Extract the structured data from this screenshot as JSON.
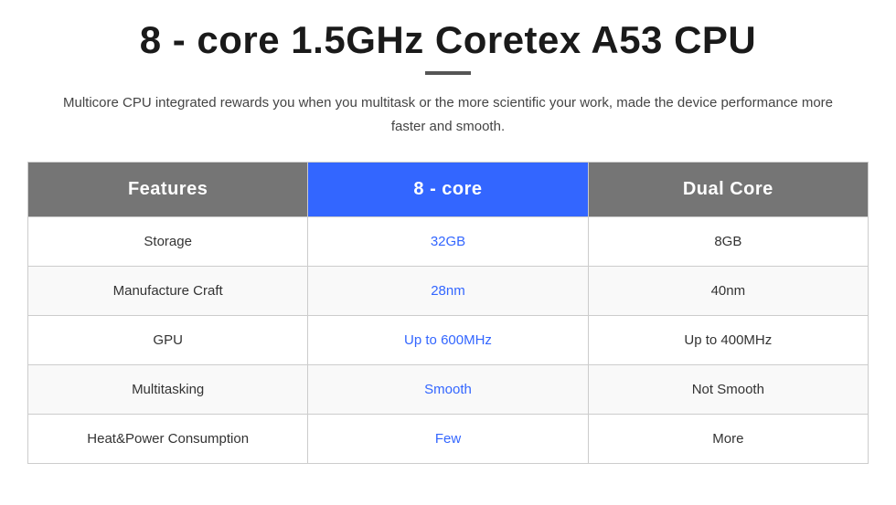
{
  "title": "8 - core 1.5GHz Coretex A53 CPU",
  "subtitle": "Multicore CPU integrated rewards you when you multitask or the more scientific your work, made the device performance more faster and smooth.",
  "table": {
    "headers": {
      "features": "Features",
      "col1": "8 - core",
      "col2": "Dual Core"
    },
    "rows": [
      {
        "feature": "Storage",
        "col1": "32GB",
        "col2": "8GB",
        "col1_highlight": true,
        "col2_highlight": false
      },
      {
        "feature": "Manufacture Craft",
        "col1": "28nm",
        "col2": "40nm",
        "col1_highlight": true,
        "col2_highlight": false
      },
      {
        "feature": "GPU",
        "col1": "Up to 600MHz",
        "col2": "Up to 400MHz",
        "col1_highlight": true,
        "col2_highlight": false
      },
      {
        "feature": "Multitasking",
        "col1": "Smooth",
        "col2": "Not Smooth",
        "col1_highlight": true,
        "col2_highlight": false
      },
      {
        "feature": "Heat&Power Consumption",
        "col1": "Few",
        "col2": "More",
        "col1_highlight": true,
        "col2_highlight": false
      }
    ]
  }
}
